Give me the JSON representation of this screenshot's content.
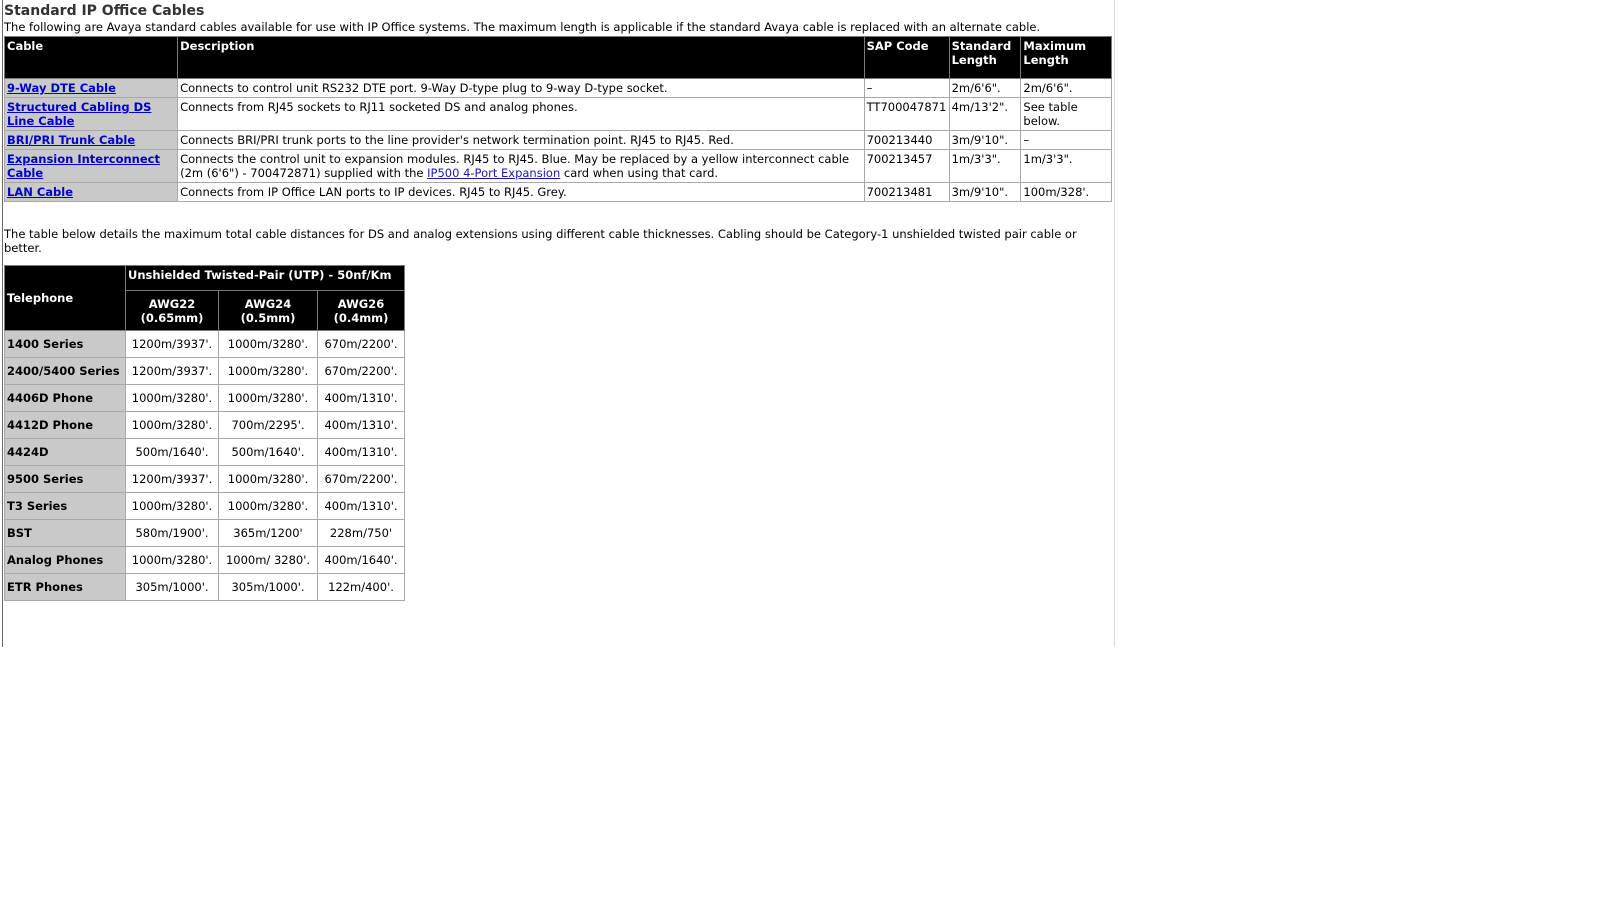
{
  "heading": "Standard IP Office Cables",
  "intro": "The following are Avaya standard cables available for use with IP Office systems. The maximum length is applicable if the standard Avaya cable is replaced with an alternate cable.",
  "cables_table": {
    "headers": {
      "cable": "Cable",
      "description": "Description",
      "sap": "SAP Code",
      "standard": "Standard Length",
      "maximum": "Maximum Length"
    },
    "rows": [
      {
        "name": "9-Way DTE Cable",
        "description": "Connects to control unit RS232 DTE port. 9-Way D-type plug to 9-way D-type socket.",
        "sap": "–",
        "standard": "2m/6'6\".",
        "maximum": "2m/6'6\"."
      },
      {
        "name": "Structured Cabling DS Line Cable",
        "description": "Connects from RJ45 sockets to RJ11 socketed DS and analog phones.",
        "sap": "TT700047871",
        "standard": "4m/13'2\".",
        "maximum": "See table below."
      },
      {
        "name": "BRI/PRI Trunk Cable",
        "description": "Connects BRI/PRI trunk ports to the line provider's network termination point. RJ45 to RJ45. Red.",
        "sap": "700213440",
        "standard": "3m/9'10\".",
        "maximum": "–"
      },
      {
        "name": "Expansion Interconnect Cable",
        "description_before": "Connects the control unit to expansion modules. RJ45 to RJ45. Blue. May be replaced by a yellow interconnect cable (2m (6'6\") - 700472871) supplied with the ",
        "description_link": "IP500 4-Port Expansion",
        "description_after": " card when using that card.",
        "sap": "700213457",
        "standard": "1m/3'3\".",
        "maximum": "1m/3'3\"."
      },
      {
        "name": "LAN Cable",
        "description": "Connects from IP Office LAN ports to IP devices. RJ45 to RJ45. Grey.",
        "sap": "700213481",
        "standard": "3m/9'10\".",
        "maximum": "100m/328'."
      }
    ]
  },
  "distance_note": "The table below details the maximum total cable distances for DS and analog extensions using different cable thicknesses. Cabling should be Category-1 unshielded twisted pair cable or better.",
  "phones_table": {
    "telephone_header": "Telephone",
    "group_header": "Unshielded Twisted-Pair (UTP) - 50nf/Km",
    "columns": [
      {
        "line1": "AWG22",
        "line2": "(0.65mm)"
      },
      {
        "line1": "AWG24",
        "line2": "(0.5mm)"
      },
      {
        "line1": "AWG26",
        "line2": "(0.4mm)"
      }
    ],
    "rows": [
      {
        "name": "1400 Series",
        "v": [
          "1200m/3937'.",
          "1000m/3280'.",
          "670m/2200'."
        ]
      },
      {
        "name": "2400/5400 Series",
        "v": [
          "1200m/3937'.",
          "1000m/3280'.",
          "670m/2200'."
        ]
      },
      {
        "name": "4406D Phone",
        "v": [
          "1000m/3280'.",
          "1000m/3280'.",
          "400m/1310'."
        ]
      },
      {
        "name": "4412D Phone",
        "v": [
          "1000m/3280'.",
          "700m/2295'.",
          "400m/1310'."
        ]
      },
      {
        "name": "4424D",
        "v": [
          "500m/1640'.",
          "500m/1640'.",
          "400m/1310'."
        ]
      },
      {
        "name": "9500 Series",
        "v": [
          "1200m/3937'.",
          "1000m/3280'.",
          "670m/2200'."
        ]
      },
      {
        "name": "T3 Series",
        "v": [
          "1000m/3280'.",
          "1000m/3280'.",
          "400m/1310'."
        ]
      },
      {
        "name": "BST",
        "v": [
          "580m/1900'.",
          "365m/1200'",
          "228m/750'"
        ]
      },
      {
        "name": "Analog Phones",
        "v": [
          "1000m/3280'.",
          "1000m/ 3280'.",
          "400m/1640'."
        ]
      },
      {
        "name": "ETR Phones",
        "v": [
          "305m/1000'.",
          "305m/1000'.",
          "122m/400'."
        ]
      }
    ]
  }
}
